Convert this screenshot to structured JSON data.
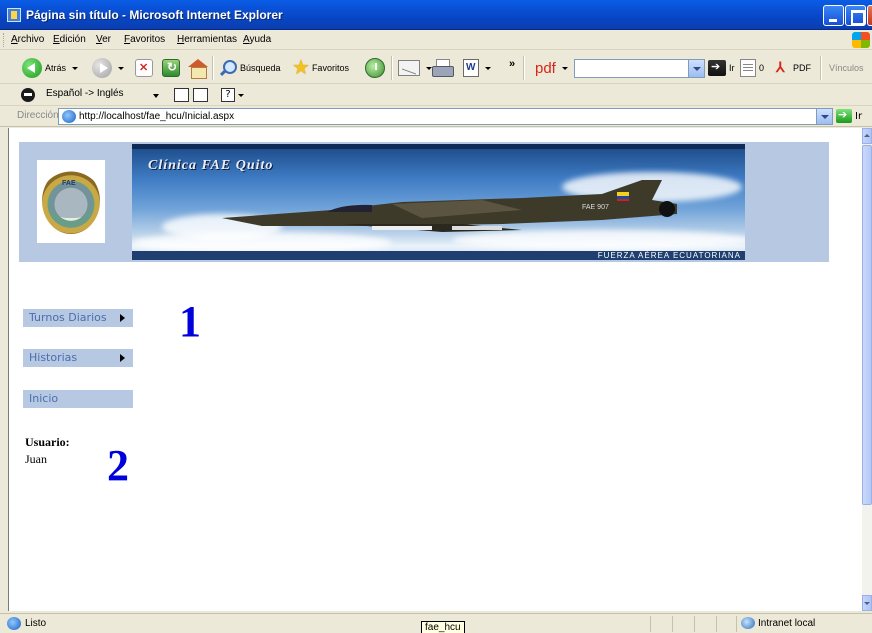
{
  "window": {
    "title": "Página sin título - Microsoft Internet Explorer"
  },
  "menubar": {
    "items": [
      "Archivo",
      "Edición",
      "Ver",
      "Favoritos",
      "Herramientas",
      "Ayuda"
    ]
  },
  "toolbar": {
    "back_label": "Atrás",
    "search_label": "Búsqueda",
    "favorites_label": "Favoritos",
    "pdf_label": "pdf",
    "go_label": "Ir",
    "count_label": "0",
    "pdf_button_label": "PDF",
    "links_label": "Vínculos",
    "chevron": "»"
  },
  "langbar": {
    "selection": "Español -> Inglés"
  },
  "address": {
    "label": "Dirección",
    "url": "http://localhost/fae_hcu/Inicial.aspx",
    "go_label": "Ir"
  },
  "banner": {
    "title": "Clínica FAE Quito",
    "subtitle": "FUERZA AÉREA ECUATORIANA",
    "logo_text": "FAE",
    "tail_text": "FAE 907"
  },
  "nav": {
    "items": [
      {
        "label": "Turnos Diarios",
        "has_submenu": true
      },
      {
        "label": "Historias",
        "has_submenu": true
      },
      {
        "label": "Inicio",
        "has_submenu": false
      }
    ]
  },
  "annotations": {
    "one": "1",
    "two": "2"
  },
  "user": {
    "label": "Usuario:",
    "name": "Juan"
  },
  "statusbar": {
    "status": "Listo",
    "zone": "Intranet local"
  },
  "tooltip": "fae_hcu",
  "colors": {
    "banner_bg": "#b7c9e2",
    "nav_text": "#4b6dae",
    "annotation": "#0000dd",
    "title_bar": "#0846c6"
  }
}
